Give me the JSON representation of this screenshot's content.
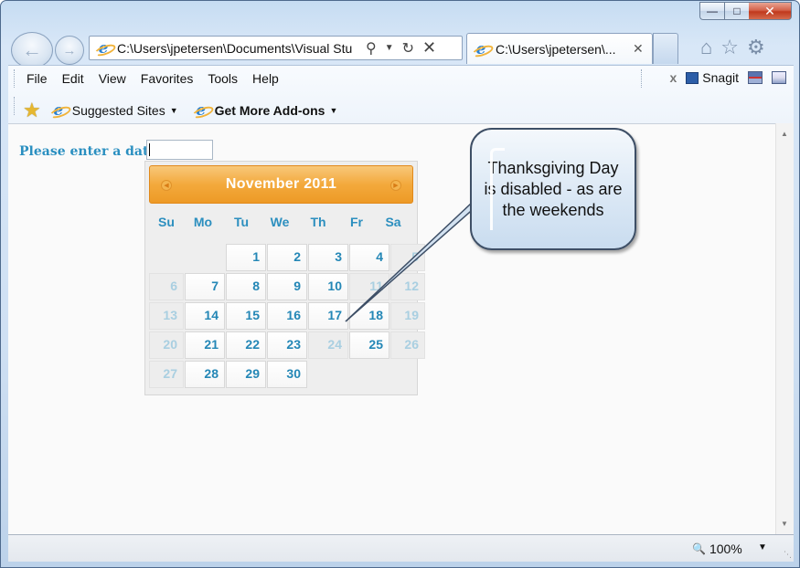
{
  "window": {
    "caption_buttons": {
      "minimize": "—",
      "maximize": "□",
      "close": "✕"
    }
  },
  "nav": {
    "address": "C:\\Users\\jpetersen\\Documents\\Visual Stu",
    "tab_title": "C:\\Users\\jpetersen\\...",
    "tab_close": "✕"
  },
  "menu": {
    "items": [
      "File",
      "Edit",
      "View",
      "Favorites",
      "Tools",
      "Help"
    ]
  },
  "addons": {
    "close": "x",
    "snagit": "Snagit"
  },
  "favorites": {
    "suggested_sites": "Suggested Sites",
    "get_more_addons": "Get More Add-ons"
  },
  "form": {
    "label": "Please enter a date:",
    "value": ""
  },
  "datepicker": {
    "title": "November 2011",
    "prev": "◀",
    "next": "▶",
    "days_of_week": [
      "Su",
      "Mo",
      "Tu",
      "We",
      "Th",
      "Fr",
      "Sa"
    ],
    "weeks": [
      [
        "",
        "",
        "1",
        "2",
        "3",
        "4",
        "5"
      ],
      [
        "6",
        "7",
        "8",
        "9",
        "10",
        "11",
        "12"
      ],
      [
        "13",
        "14",
        "15",
        "16",
        "17",
        "18",
        "19"
      ],
      [
        "20",
        "21",
        "22",
        "23",
        "24",
        "25",
        "26"
      ],
      [
        "27",
        "28",
        "29",
        "30",
        "",
        "",
        ""
      ]
    ]
  },
  "callout": {
    "text": "Thanksgiving Day is disabled - as are the weekends"
  },
  "status": {
    "zoom": "100%"
  },
  "colors": {
    "label": "#2a8fc0",
    "date_text": "#2487b6",
    "disabled_text": "#a9cfe1",
    "header_orange": "#f3a93c"
  }
}
